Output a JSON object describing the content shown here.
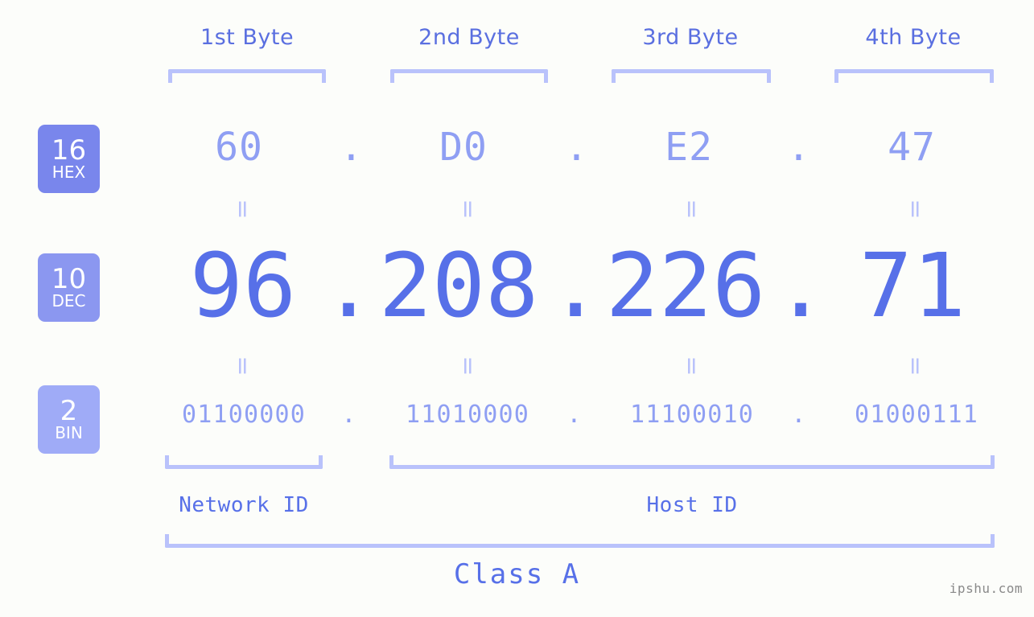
{
  "background_color": "#fcfdfa",
  "accent_color": "#5770e8",
  "light_accent_color": "#b9c2fb",
  "mid_accent_color": "#8f9ff3",
  "header": {
    "byte_labels": [
      "1st Byte",
      "2nd Byte",
      "3rd Byte",
      "4th Byte"
    ]
  },
  "systems": [
    {
      "base": "16",
      "name": "HEX",
      "badge_color": "#7986ec"
    },
    {
      "base": "10",
      "name": "DEC",
      "badge_color": "#8b97f0"
    },
    {
      "base": "2",
      "name": "BIN",
      "badge_color": "#9fabf7"
    }
  ],
  "separator": ".",
  "equals": "=",
  "rows": {
    "hex": {
      "octets": [
        "60",
        "D0",
        "E2",
        "47"
      ]
    },
    "dec": {
      "octets": [
        "96",
        "208",
        "226",
        "71"
      ]
    },
    "bin": {
      "octets": [
        "01100000",
        "11010000",
        "11100010",
        "01000111"
      ]
    }
  },
  "ip_address": "96.208.226.71",
  "segments": {
    "network_id_label": "Network ID",
    "host_id_label": "Host ID"
  },
  "class_label": "Class A",
  "watermark": "ipshu.com"
}
